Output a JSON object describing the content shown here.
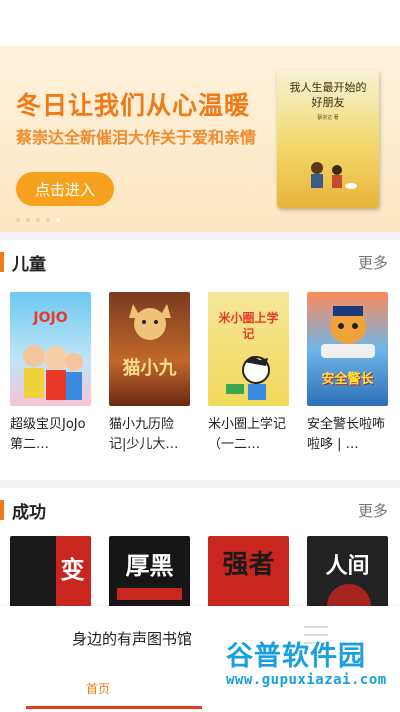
{
  "banner": {
    "title": "冬日让我们从心温暖",
    "subtitle": "蔡崇达全新催泪大作关于爱和亲情",
    "button_label": "点击进入",
    "book_title_line1": "我人生最开始的",
    "book_title_line2": "好朋友",
    "book_author": "蔡崇达 著"
  },
  "sections": {
    "children": {
      "title": "儿童",
      "more": "更多",
      "books": [
        {
          "title": "超级宝贝JoJo第二…",
          "cover_text": "JOJO"
        },
        {
          "title": "猫小九历险记|少儿大…",
          "cover_text": "猫小九"
        },
        {
          "title": "米小圈上学记（一二…",
          "cover_text": "米小圈上学记"
        },
        {
          "title": "安全警长啦咘啦哆 | …",
          "cover_text": "安全警长"
        }
      ]
    },
    "success": {
      "title": "成功",
      "more": "更多",
      "books": [
        {
          "cover_text": "变"
        },
        {
          "cover_text": "厚黑"
        },
        {
          "cover_text": "强者"
        },
        {
          "cover_text": "人间"
        }
      ]
    }
  },
  "panel": {
    "title": "身边的有声图书馆",
    "nav_home": "首页"
  },
  "watermark": {
    "line1": "谷普软件园",
    "line2": "www.gupuxiazai.com"
  },
  "colors": {
    "accent": "#f07a18",
    "banner_button": "#f7a21e",
    "nav_active_line": "#e53b1e",
    "watermark": "#1a9fe0"
  }
}
